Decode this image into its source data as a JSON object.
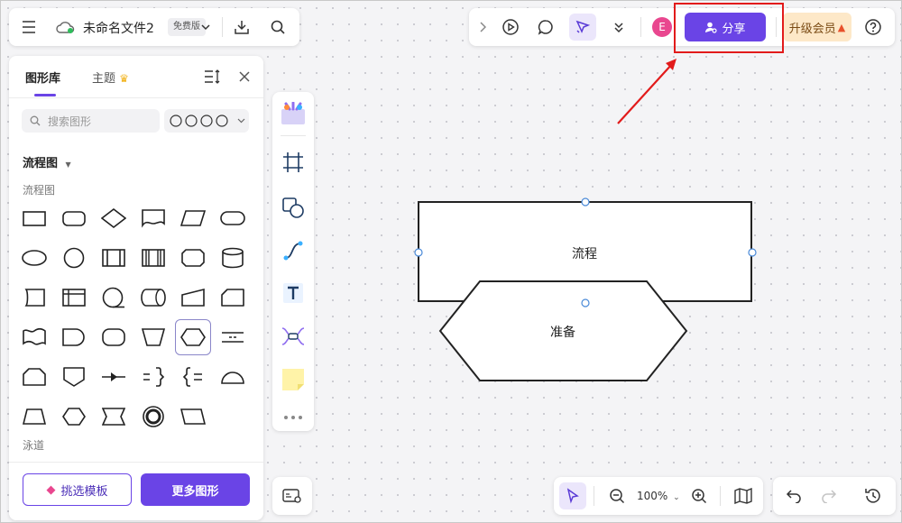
{
  "header": {
    "doc_title": "未命名文件2",
    "badge": "免费版"
  },
  "topbar": {
    "avatar_letter": "E",
    "share_label": "分享",
    "upgrade_label": "升级会员"
  },
  "panel": {
    "tab_library": "图形库",
    "tab_theme": "主题",
    "search_placeholder": "搜索图形",
    "section_title": "流程图",
    "subsection_flow": "流程图",
    "subsection_lane": "泳道",
    "btn_template": "挑选模板",
    "btn_more": "更多图形"
  },
  "canvas": {
    "shape1_label": "流程",
    "shape2_label": "准备"
  },
  "zoom": {
    "value": "100%"
  },
  "colors": {
    "accent": "#6a44e6",
    "highlight": "#e21b1b",
    "upgrade_bg": "#fde8c8",
    "avatar": "#e9478f"
  }
}
